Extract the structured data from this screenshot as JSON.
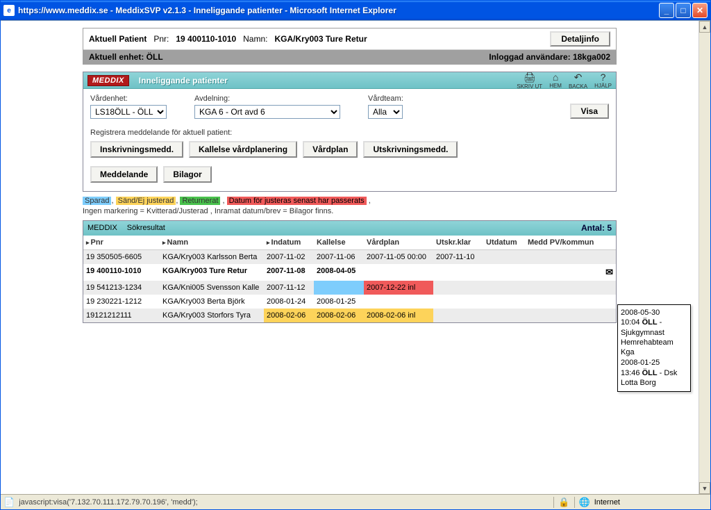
{
  "window": {
    "title": "https://www.meddix.se - MeddixSVP v2.1.3 - Inneliggande patienter - Microsoft Internet Explorer"
  },
  "patient": {
    "label": "Aktuell Patient",
    "pnr_label": "Pnr:",
    "pnr": "19 400110-1010",
    "namn_label": "Namn:",
    "namn": "KGA/Kry003 Ture Retur",
    "detaljinfo": "Detaljinfo"
  },
  "enhet": {
    "label": "Aktuell enhet: ÖLL",
    "user_label": "Inloggad användare: 18kga002"
  },
  "panel": {
    "logo": "MEDDIX",
    "title": "Inneliggande patienter",
    "icons": {
      "print": "SKRIV UT",
      "home": "HEM",
      "back": "BACKA",
      "help": "HJÄLP"
    }
  },
  "filters": {
    "vard_label": "Vårdenhet:",
    "vard_value": "LS18ÖLL - ÖLL",
    "avd_label": "Avdelning:",
    "avd_value": "KGA 6 - Ort avd 6",
    "team_label": "Vårdteam:",
    "team_value": "Alla",
    "visa": "Visa"
  },
  "register_label": "Registrera meddelande för aktuell patient:",
  "buttons": {
    "inskrivning": "Inskrivningsmedd.",
    "kallelse": "Kallelse vårdplanering",
    "vardplan": "Vårdplan",
    "utskrivning": "Utskrivningsmedd.",
    "meddelande": "Meddelande",
    "bilagor": "Bilagor"
  },
  "legend": {
    "sparad": "Sparad",
    "send": "Sänd/Ej justerad",
    "ret": "Returnerat",
    "pass": "Datum för justeras senast har passerats",
    "line2": "Ingen markering = Kvitterad/Justerad , Inramat datum/brev = Bilagor finns."
  },
  "results": {
    "logo": "MEDDIX",
    "title": "Sökresultat",
    "count_label": "Antal: 5"
  },
  "columns": {
    "pnr": "Pnr",
    "namn": "Namn",
    "indatum": "Indatum",
    "kallelse": "Kallelse",
    "vardplan": "Vårdplan",
    "utskr": "Utskr.klar",
    "utdatum": "Utdatum",
    "medd": "Medd PV/kommun"
  },
  "rows": [
    {
      "pnr": "19 350505-6605",
      "namn": "KGA/Kry003 Karlsson Berta",
      "indatum": "2007-11-02",
      "kallelse": "2007-11-06",
      "vardplan": "2007-11-05 00:00",
      "utskr": "2007-11-10",
      "utdatum": "",
      "medd": "",
      "sel": false,
      "kallelse_class": "",
      "vardplan_class": "",
      "indatum_class": "",
      "has_env": false
    },
    {
      "pnr": "19 400110-1010",
      "namn": "KGA/Kry003 Ture Retur",
      "indatum": "2007-11-08",
      "kallelse": "2008-04-05",
      "vardplan": "",
      "utskr": "",
      "utdatum": "",
      "medd": "",
      "sel": true,
      "kallelse_class": "",
      "vardplan_class": "",
      "indatum_class": "",
      "has_env": true
    },
    {
      "pnr": "19 541213-1234",
      "namn": "KGA/Kni005 Svensson Kalle",
      "indatum": "2007-11-12",
      "kallelse": "",
      "vardplan": "2007-12-22 inl",
      "utskr": "",
      "utdatum": "",
      "medd": "",
      "sel": false,
      "kallelse_class": "cell-blue",
      "vardplan_class": "cell-red",
      "indatum_class": "",
      "has_env": false
    },
    {
      "pnr": "19 230221-1212",
      "namn": "KGA/Kry003 Berta Björk",
      "indatum": "2008-01-24",
      "kallelse": "2008-01-25",
      "vardplan": "",
      "utskr": "",
      "utdatum": "",
      "medd": "",
      "sel": false,
      "kallelse_class": "",
      "vardplan_class": "",
      "indatum_class": "",
      "has_env": false
    },
    {
      "pnr": "19121212111",
      "namn": "KGA/Kry003 Storfors Tyra",
      "indatum": "2008-02-06",
      "kallelse": "2008-02-06",
      "vardplan": "2008-02-06 inl",
      "utskr": "",
      "utdatum": "",
      "medd": "",
      "sel": false,
      "kallelse_class": "cell-orange",
      "vardplan_class": "cell-orange",
      "indatum_class": "cell-orange",
      "has_env": false
    }
  ],
  "tooltip": {
    "l1a": "2008-05-30",
    "l1b": "10:04 ",
    "l1c": "ÖLL",
    "l1d": " - Sjukgymnast Hemrehabteam Kga",
    "l2a": "2008-01-25",
    "l2b": "13:46 ",
    "l2c": "ÖLL",
    "l2d": " - Dsk Lotta Borg"
  },
  "statusbar": {
    "text": "javascript:visa('7.132.70.111.172.79.70.196', 'medd');",
    "zone": "Internet"
  }
}
